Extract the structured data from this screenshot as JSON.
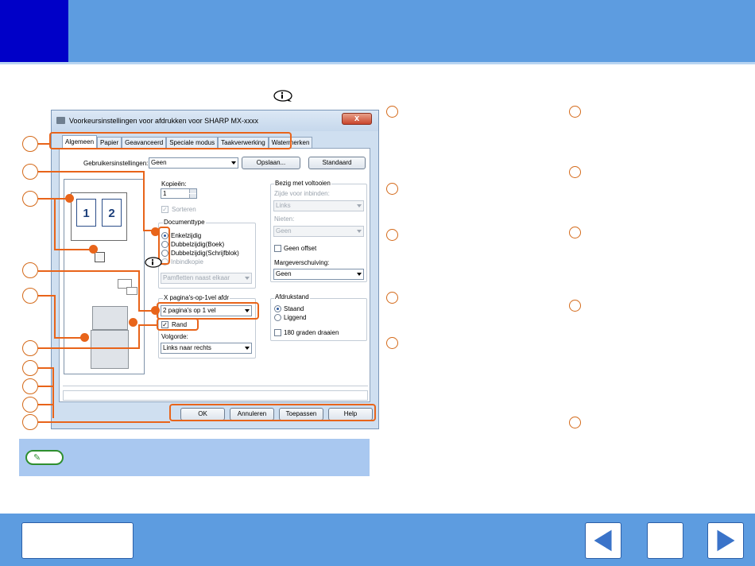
{
  "dialog": {
    "title": "Voorkeursinstellingen voor afdrukken voor SHARP MX-xxxx",
    "close_glyph": "x",
    "tabs": [
      "Algemeen",
      "Papier",
      "Geavanceerd",
      "Speciale modus",
      "Taakverwerking",
      "Watermerken"
    ],
    "user_settings_label": "Gebruikersinstellingen:",
    "user_settings_value": "Geen",
    "save_label": "Opslaan...",
    "default_label": "Standaard",
    "copies_label": "Kopieën:",
    "copies_value": "1",
    "collate_label": "Sorteren",
    "doc_style_label": "Documenttype",
    "doc_style_options": [
      "Enkelzijdig",
      "Dubbelzijdig(Boek)",
      "Dubbelzijdig(Schrijfblok)",
      "Inbindkopie"
    ],
    "booklet_select": "Pamfletten naast elkaar",
    "nup_label": "X pagina's-op-1vel afdr",
    "nup_value": "2 pagina's op 1 vel",
    "border_label": "Rand",
    "order_label": "Volgorde:",
    "order_value": "Links naar rechts",
    "finishing_label": "Bezig met voltooien",
    "binding_edge_label": "Zijde voor inbinden:",
    "binding_edge_value": "Links",
    "staple_label": "Nieten:",
    "staple_value": "Geen",
    "offset_label": "Geen offset",
    "margin_shift_label": "Margeverschuiving:",
    "margin_shift_value": "Geen",
    "orientation_label": "Afdrukstand",
    "orientation_options": [
      "Staand",
      "Liggend"
    ],
    "rotate_label": "180 graden draaien",
    "preview_pages": [
      "1",
      "2"
    ],
    "footer_buttons": [
      "OK",
      "Annuleren",
      "Toepassen",
      "Help"
    ]
  },
  "colors": {
    "header": "#5d9ce0",
    "header_accent": "#0000c8",
    "callout": "#e8641a",
    "note_bg": "#a9c8f0"
  },
  "icons": {
    "info": "info-icon",
    "note": "note-pencil-icon",
    "prev": "arrow-left-icon",
    "next": "arrow-right-icon"
  }
}
